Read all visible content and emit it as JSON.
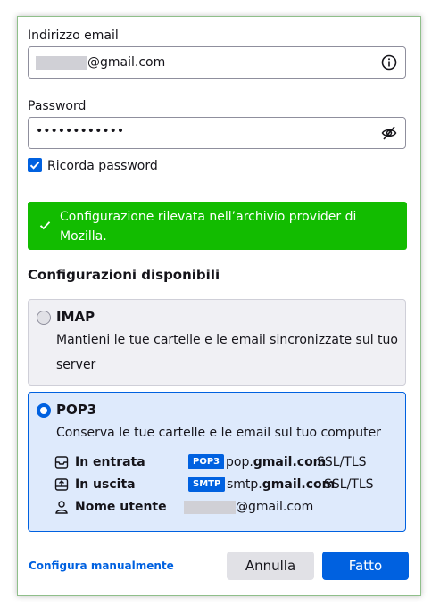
{
  "email": {
    "label": "Indirizzo email",
    "value_suffix": "@gmail.com"
  },
  "password": {
    "label": "Password",
    "value": "••••••••••••"
  },
  "remember": {
    "label": "Ricorda password",
    "checked": true
  },
  "notice": {
    "text": "Configurazione rilevata nell’archivio provider di Mozilla.",
    "color": "#12bc00"
  },
  "configs": {
    "title": "Configurazioni disponibili",
    "imap": {
      "title": "IMAP",
      "description": "Mantieni le tue cartelle e le email sincronizzate sul tuo server",
      "selected": false
    },
    "pop3": {
      "title": "POP3",
      "description": "Conserva le tue cartelle e le email sul tuo computer",
      "selected": true,
      "incoming": {
        "label": "In entrata",
        "badge": "POP3",
        "host_prefix": "pop.",
        "host_domain": "gmail.com",
        "security": "SSL/TLS"
      },
      "outgoing": {
        "label": "In uscita",
        "badge": "SMTP",
        "host_prefix": "smtp.",
        "host_domain": "gmail.com",
        "security": "SSL/TLS"
      },
      "username": {
        "label": "Nome utente",
        "value_suffix": "@gmail.com"
      }
    }
  },
  "footer": {
    "manual_link": "Configura manualmente",
    "cancel": "Annulla",
    "done": "Fatto"
  },
  "colors": {
    "accent": "#0061e0",
    "selected_card_bg": "#deeafc"
  }
}
